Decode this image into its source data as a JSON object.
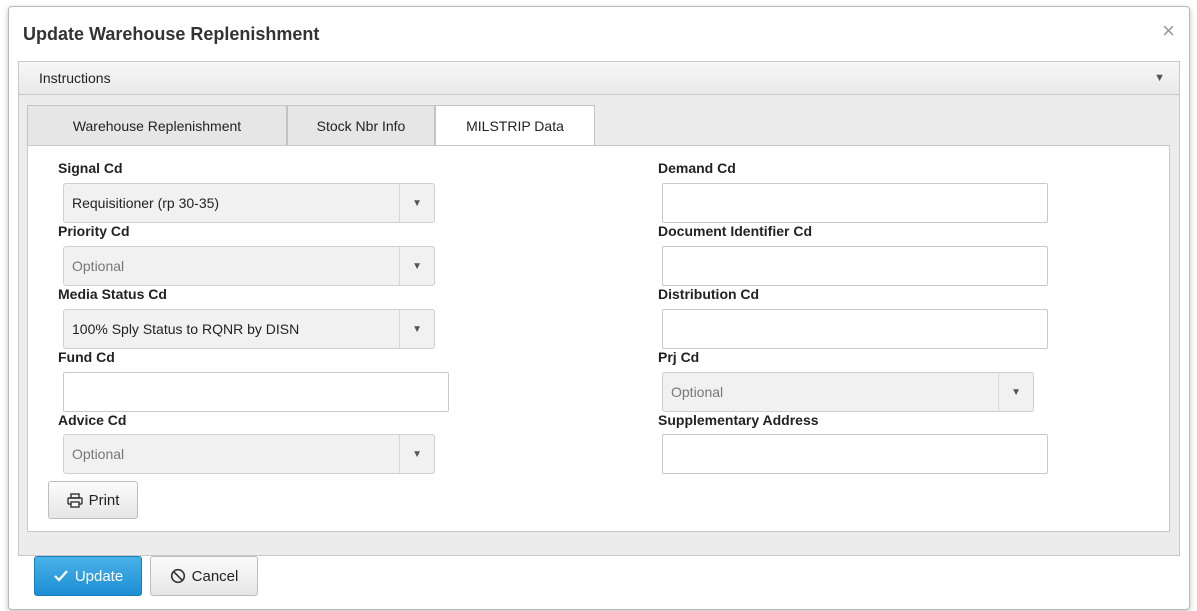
{
  "dialog": {
    "title": "Update Warehouse Replenishment",
    "close_glyph": "×"
  },
  "instructions": {
    "label": "Instructions",
    "caret_glyph": "▼"
  },
  "tabs": [
    {
      "label": "Warehouse Replenishment",
      "active": false
    },
    {
      "label": "Stock Nbr Info",
      "active": false
    },
    {
      "label": "MILSTRIP Data",
      "active": true
    }
  ],
  "form": {
    "signal_cd": {
      "label": "Signal Cd",
      "value": "Requisitioner (rp 30-35)"
    },
    "priority_cd": {
      "label": "Priority Cd",
      "placeholder": "Optional"
    },
    "media_status_cd": {
      "label": "Media Status Cd",
      "value": "100% Sply Status to RQNR by DISN"
    },
    "fund_cd": {
      "label": "Fund Cd",
      "value": ""
    },
    "advice_cd": {
      "label": "Advice Cd",
      "placeholder": "Optional"
    },
    "demand_cd": {
      "label": "Demand Cd",
      "value": ""
    },
    "document_identifier_cd": {
      "label": "Document Identifier Cd",
      "value": ""
    },
    "distribution_cd": {
      "label": "Distribution Cd",
      "value": ""
    },
    "prj_cd": {
      "label": "Prj Cd",
      "placeholder": "Optional"
    },
    "supplementary_address": {
      "label": "Supplementary Address",
      "value": ""
    }
  },
  "buttons": {
    "print": {
      "label": "Print",
      "icon": "printer-icon"
    },
    "update": {
      "label": "Update",
      "icon": "check-icon"
    },
    "cancel": {
      "label": "Cancel",
      "icon": "ban-icon"
    }
  },
  "colors": {
    "primary": "#1d8ed3",
    "panel_bg": "#ececec"
  }
}
